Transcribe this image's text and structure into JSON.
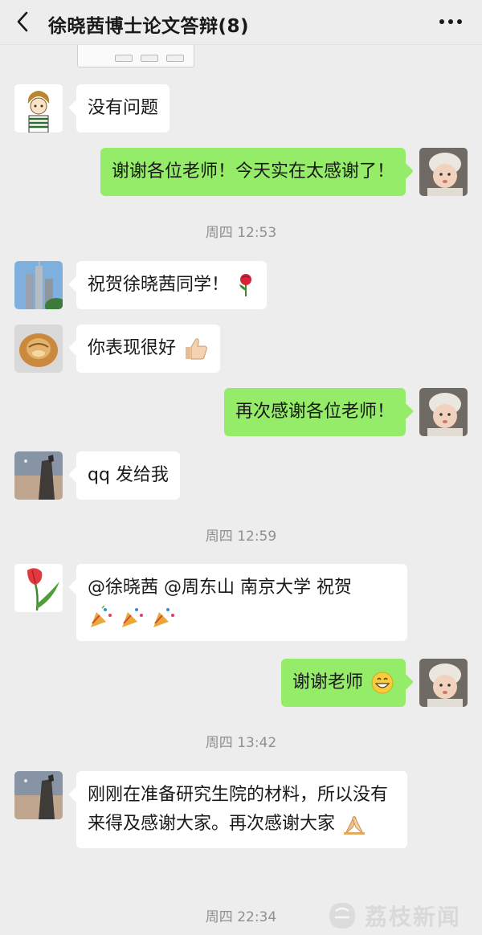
{
  "header": {
    "title": "徐晓茜博士论文答辩(8)"
  },
  "timestamps": [
    "周四 12:53",
    "周四 12:59",
    "周四 13:42",
    "周四 22:34"
  ],
  "messages": [
    {
      "side": "in",
      "text": "没有问题"
    },
    {
      "side": "out",
      "text": "谢谢各位老师！今天实在太感谢了！"
    },
    {
      "side": "in",
      "text": "祝贺徐晓茜同学！",
      "emoji": "rose-emoji"
    },
    {
      "side": "in",
      "text": "你表现很好",
      "emoji": "thumbs-up-emoji"
    },
    {
      "side": "out",
      "text": "再次感谢各位老师！"
    },
    {
      "side": "in",
      "text": "qq 发给我"
    },
    {
      "side": "in",
      "text": "@徐晓茜 @周东山 南京大学  祝贺",
      "emoji": "party-popper-emoji"
    },
    {
      "side": "out",
      "text": "谢谢老师",
      "emoji": "grin-emoji"
    },
    {
      "side": "in",
      "text": "刚刚在准备研究生院的材料，所以没有来得及感谢大家。再次感谢大家",
      "emoji": "folded-hands-emoji"
    }
  ],
  "watermark": {
    "text": "荔枝新闻"
  },
  "colors": {
    "background": "#ededed",
    "bubble_in": "#ffffff",
    "bubble_out": "#95ec69",
    "timestamp": "#8f8f8f"
  }
}
